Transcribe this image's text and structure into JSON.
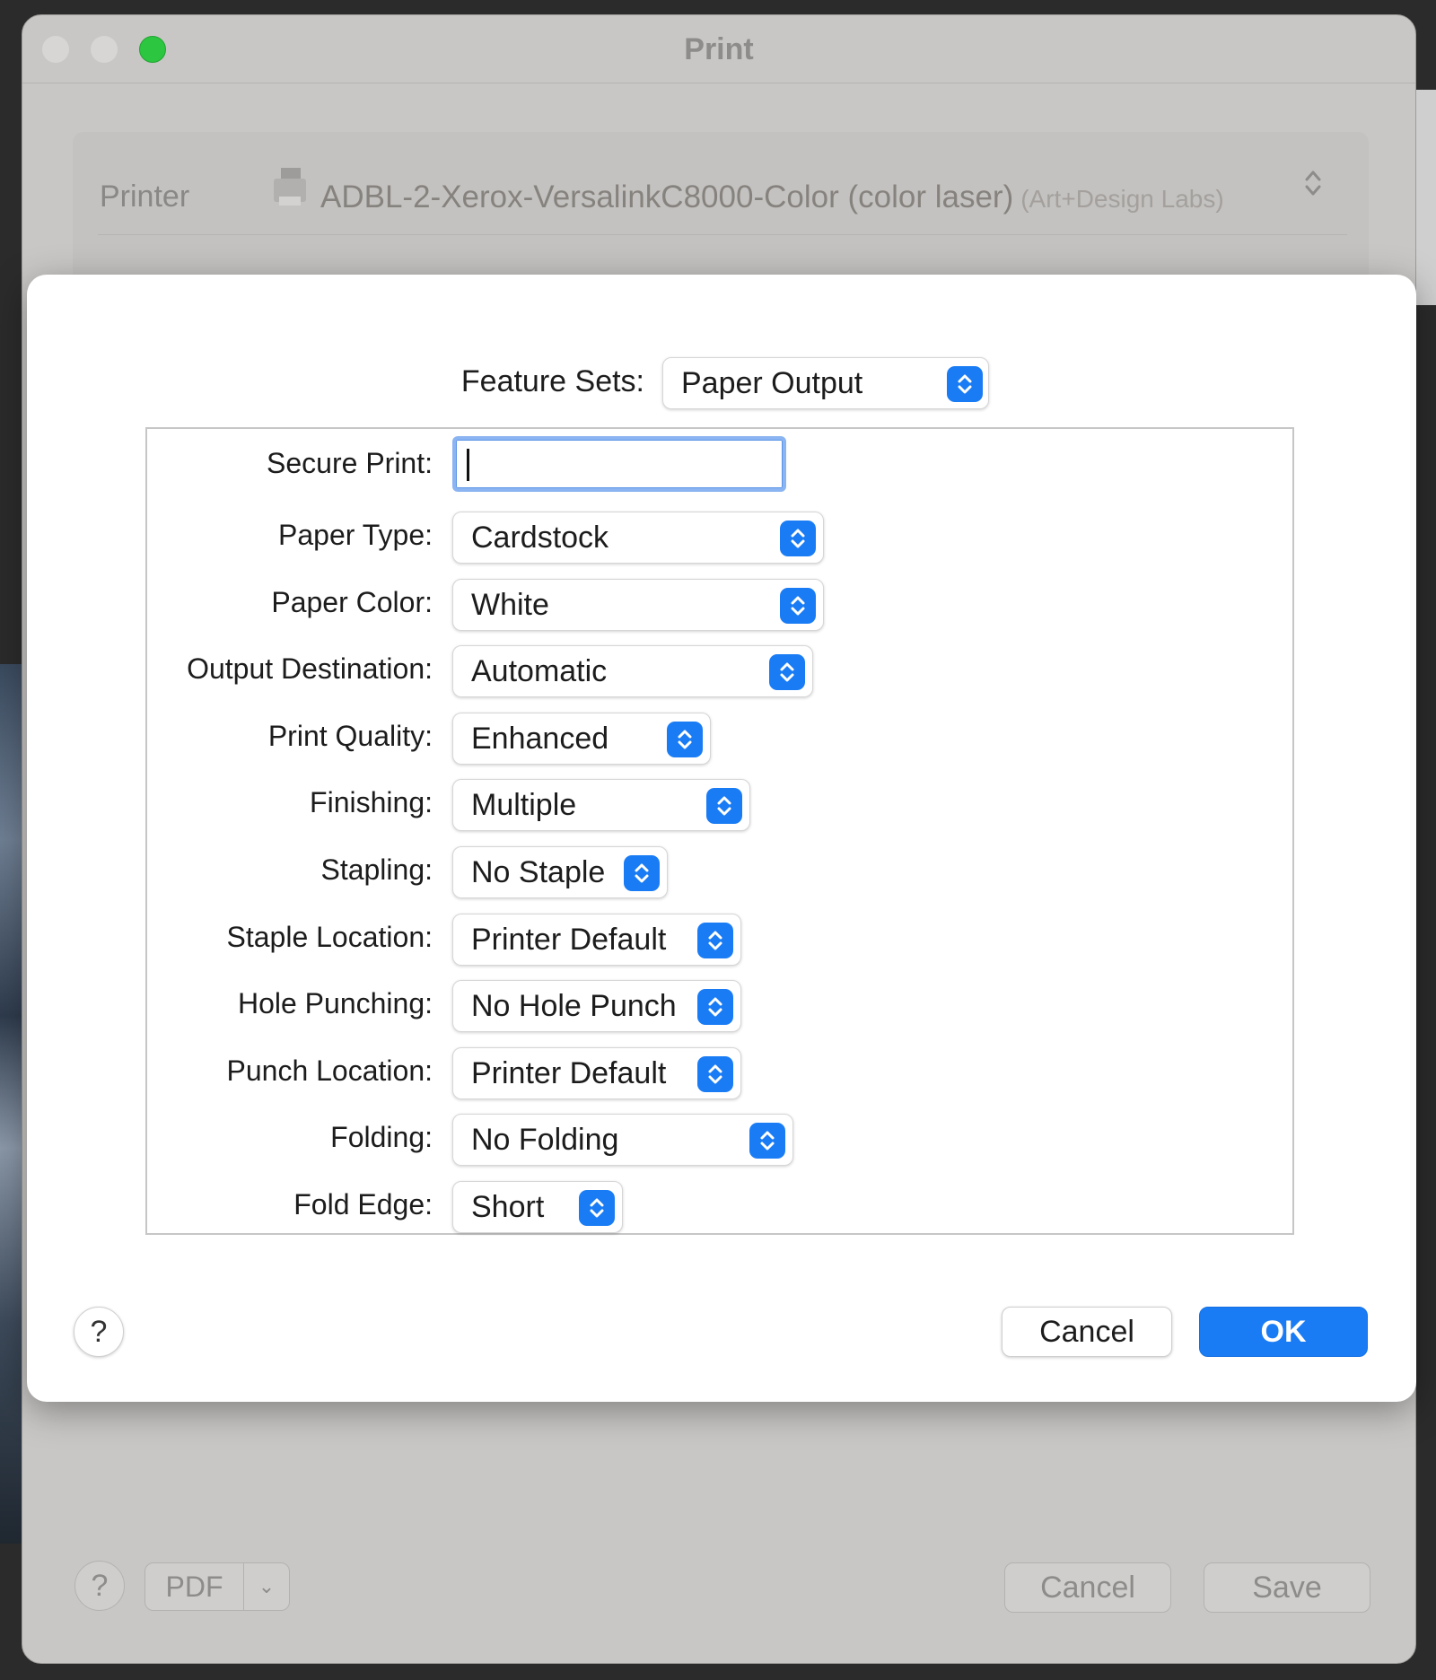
{
  "window": {
    "title": "Print",
    "printer_label": "Printer",
    "printer_name": "ADBL-2-Xerox-VersalinkC8000-Color (color laser)",
    "printer_location": "(Art+Design Labs)",
    "pdf_label": "PDF",
    "cancel_label": "Cancel",
    "save_label": "Save",
    "help_label": "?"
  },
  "sheet": {
    "feature_sets_label": "Feature Sets:",
    "feature_sets_value": "Paper Output",
    "secure_print_label": "Secure Print:",
    "secure_print_value": "",
    "rows": [
      {
        "label": "Paper Type:",
        "value": "Cardstock"
      },
      {
        "label": "Paper Color:",
        "value": "White"
      },
      {
        "label": "Output Destination:",
        "value": "Automatic"
      },
      {
        "label": "Print Quality:",
        "value": "Enhanced"
      },
      {
        "label": "Finishing:",
        "value": "Multiple"
      },
      {
        "label": "Stapling:",
        "value": "No Staple"
      },
      {
        "label": "Staple Location:",
        "value": "Printer Default"
      },
      {
        "label": "Hole Punching:",
        "value": "No Hole Punch"
      },
      {
        "label": "Punch Location:",
        "value": "Printer Default"
      },
      {
        "label": "Folding:",
        "value": "No Folding"
      },
      {
        "label": "Fold Edge:",
        "value": "Short"
      }
    ],
    "help_label": "?",
    "cancel_label": "Cancel",
    "ok_label": "OK"
  },
  "colors": {
    "accent": "#1a7cf5",
    "focus_ring": "#8ab4f2",
    "window_bg": "#c9c7c5",
    "sheet_bg": "#ffffff"
  }
}
